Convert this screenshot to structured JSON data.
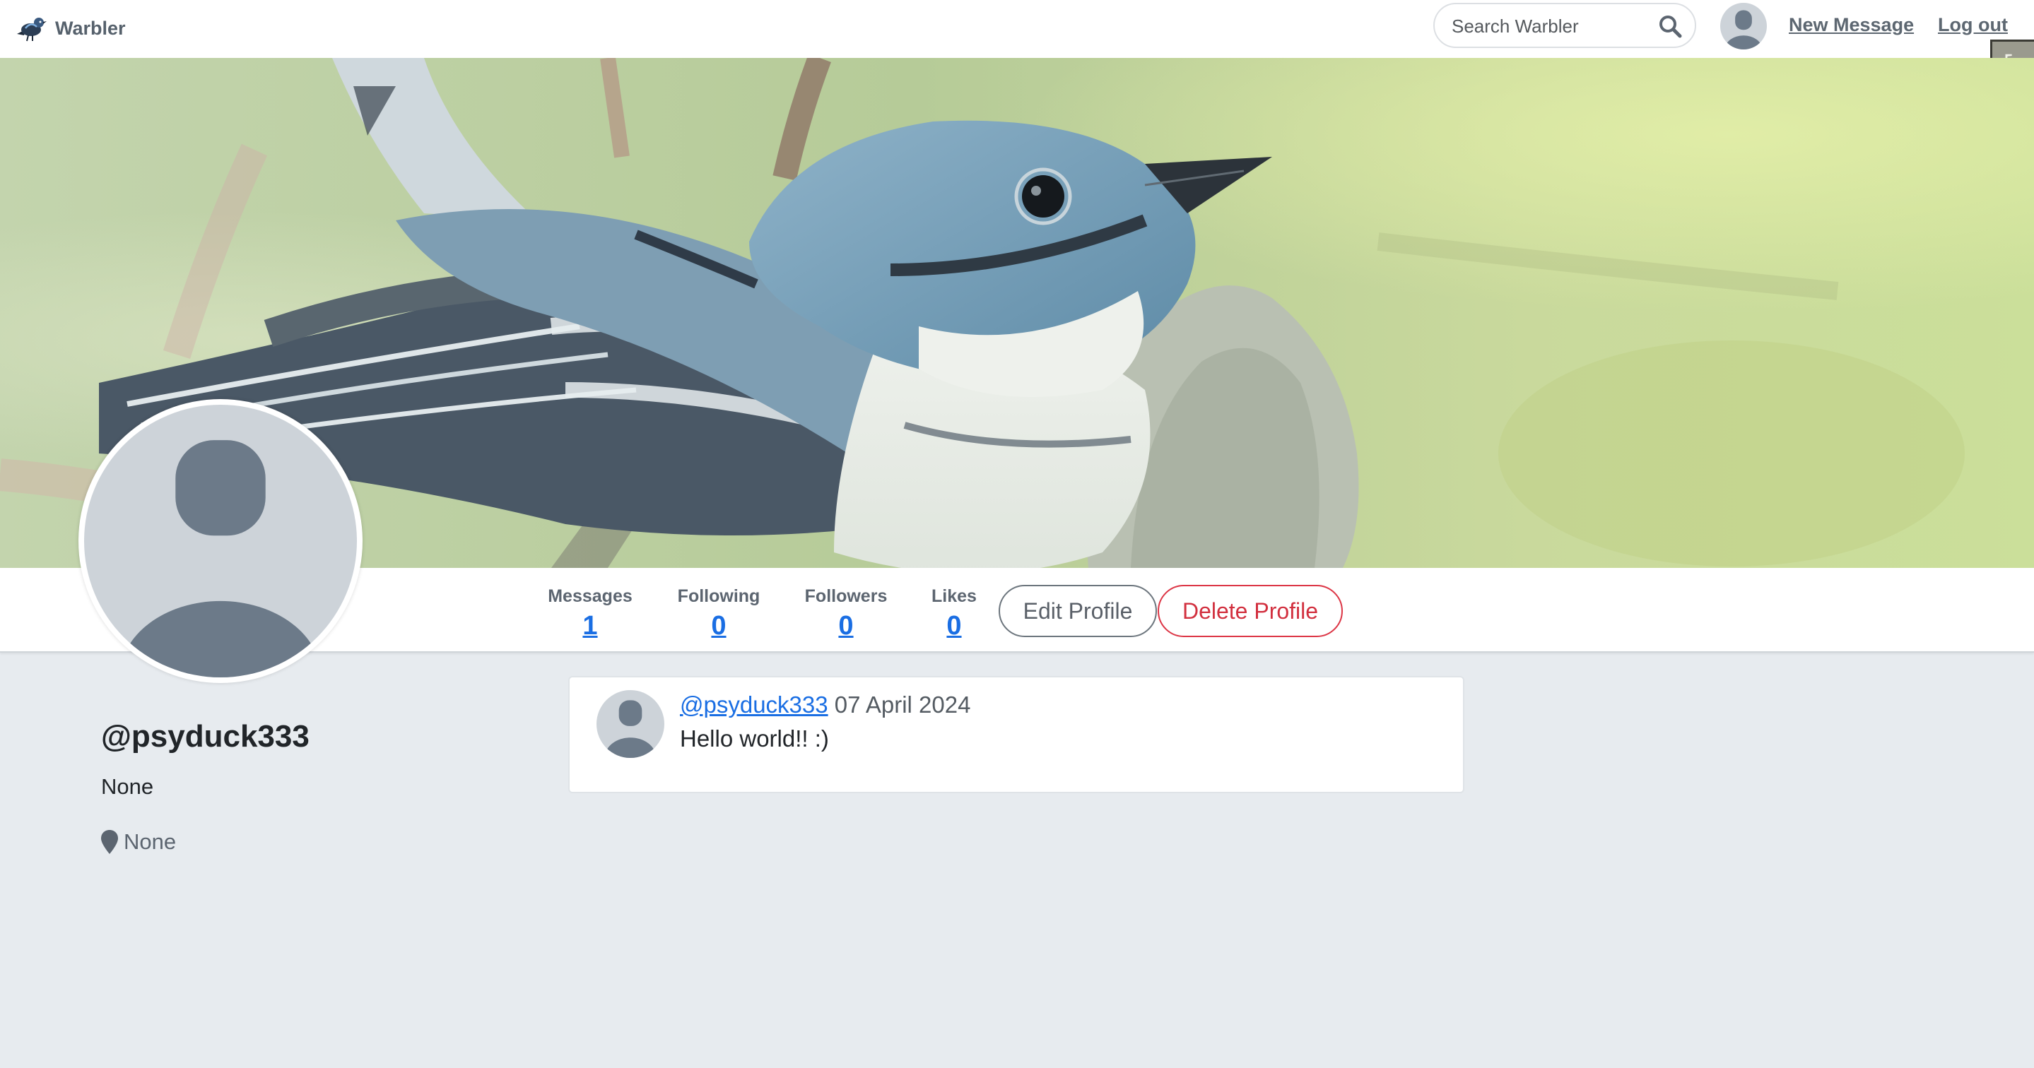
{
  "navbar": {
    "brand_name": "Warbler",
    "search_placeholder": "Search Warbler",
    "new_message_label": "New Message",
    "logout_label": "Log out",
    "edge_badge_text": "FDT"
  },
  "profile": {
    "username": "@psyduck333",
    "bio": "None",
    "location": "None"
  },
  "stats": [
    {
      "label": "Messages",
      "value": "1"
    },
    {
      "label": "Following",
      "value": "0"
    },
    {
      "label": "Followers",
      "value": "0"
    },
    {
      "label": "Likes",
      "value": "0"
    }
  ],
  "actions": {
    "edit_label": "Edit Profile",
    "delete_label": "Delete Profile"
  },
  "messages": [
    {
      "user": "@psyduck333",
      "date": "07 April 2024",
      "text": "Hello world!! :)"
    }
  ],
  "colors": {
    "link": "#1a6ee3",
    "danger": "#dc3545",
    "page_bg": "#e7ebef",
    "avatar_bg": "#cdd3d9",
    "avatar_fg": "#6c7a89"
  },
  "icons": {
    "brand": "warbler-bird-icon",
    "search": "search-icon",
    "location": "map-pin-icon",
    "avatar": "default-avatar-icon"
  }
}
